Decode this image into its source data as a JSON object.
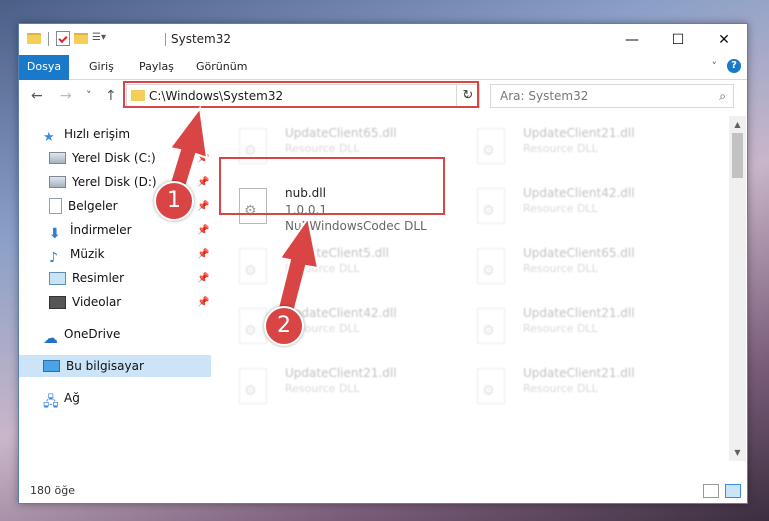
{
  "window": {
    "title": "System32",
    "controls": {
      "minimize": "—",
      "maximize": "☐",
      "close": "✕"
    }
  },
  "ribbon": {
    "tabs": [
      "Dosya",
      "Giriş",
      "Paylaş",
      "Görünüm"
    ]
  },
  "navigation": {
    "back": "←",
    "forward": "→",
    "recent": "˅",
    "up": "↑",
    "address": "C:\\Windows\\System32",
    "address_dropdown": "⌄",
    "refresh": "↻",
    "search_placeholder": "Ara: System32"
  },
  "sidebar": {
    "items": [
      {
        "label": "Hızlı erişim",
        "icon": "star-icon"
      },
      {
        "label": "Yerel Disk (C:)",
        "icon": "drive-icon",
        "pinned": true
      },
      {
        "label": "Yerel Disk (D:)",
        "icon": "drive-icon",
        "pinned": true
      },
      {
        "label": "Belgeler",
        "icon": "documents-icon",
        "pinned": true
      },
      {
        "label": "İndirmeler",
        "icon": "downloads-icon",
        "pinned": true
      },
      {
        "label": "Müzik",
        "icon": "music-icon",
        "pinned": true
      },
      {
        "label": "Resimler",
        "icon": "pictures-icon",
        "pinned": true
      },
      {
        "label": "Videolar",
        "icon": "videos-icon",
        "pinned": true
      },
      {
        "label": "OneDrive",
        "icon": "cloud-icon"
      },
      {
        "label": "Bu bilgisayar",
        "icon": "computer-icon",
        "selected": true
      },
      {
        "label": "Ağ",
        "icon": "network-icon"
      }
    ]
  },
  "files": {
    "highlighted": {
      "name": "nub.dll",
      "version": "1.0.0.1",
      "description": "NuBWindowsCodec DLL"
    },
    "left_column": [
      {
        "name": "UpdateClient65.dll",
        "type": "Resource DLL"
      },
      {
        "name": "UpdateClient5.dll",
        "type": "Resource DLL"
      },
      {
        "name": "UpdateClient42.dll",
        "type": "Resource DLL"
      },
      {
        "name": "UpdateClient21.dll",
        "type": "Resource DLL"
      }
    ],
    "right_column": [
      {
        "name": "UpdateClient21.dll",
        "type": "Resource DLL"
      },
      {
        "name": "UpdateClient42.dll",
        "type": "Resource DLL"
      },
      {
        "name": "UpdateClient65.dll",
        "type": "Resource DLL"
      },
      {
        "name": "UpdateClient21.dll",
        "type": "Resource DLL"
      },
      {
        "name": "UpdateClient21.dll",
        "type": "Resource DLL"
      }
    ]
  },
  "status": {
    "item_count": "180 öğe"
  },
  "annotations": {
    "step1": "1",
    "step2": "2",
    "highlight_color": "#d94545"
  }
}
